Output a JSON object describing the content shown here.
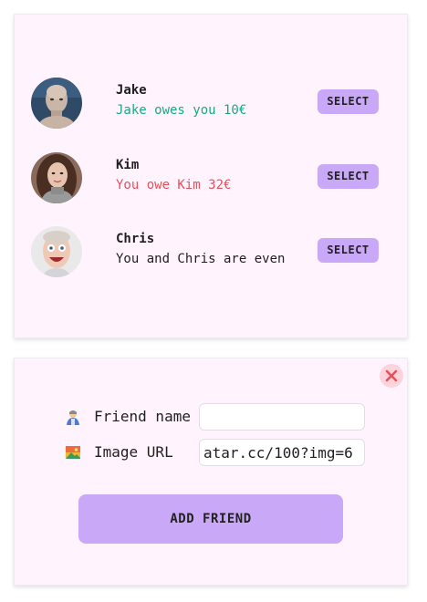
{
  "friends": [
    {
      "name": "Jake",
      "status": "Jake owes you 10€",
      "status_type": "owes_you",
      "select_label": "SELECT",
      "avatar_icon": "photo-avatar-man-bald"
    },
    {
      "name": "Kim",
      "status": "You owe Kim 32€",
      "status_type": "you_owe",
      "select_label": "SELECT",
      "avatar_icon": "photo-avatar-woman"
    },
    {
      "name": "Chris",
      "status": "You and Chris are even",
      "status_type": "even",
      "select_label": "SELECT",
      "avatar_icon": "photo-avatar-man-funny"
    }
  ],
  "form": {
    "close_icon": "close-icon",
    "friend_name_label": "Friend name",
    "friend_name_icon": "person-icon",
    "friend_name_value": "",
    "image_url_label": "Image URL",
    "image_url_icon": "image-icon",
    "image_url_value": "atar.cc/100?img=6",
    "submit_label": "ADD FRIEND"
  },
  "colors": {
    "card_bg": "#fff4fd",
    "accent": "#c9a8f7",
    "green": "#1aa882",
    "red": "#e8505b",
    "close_bg": "#fdd4dc"
  }
}
